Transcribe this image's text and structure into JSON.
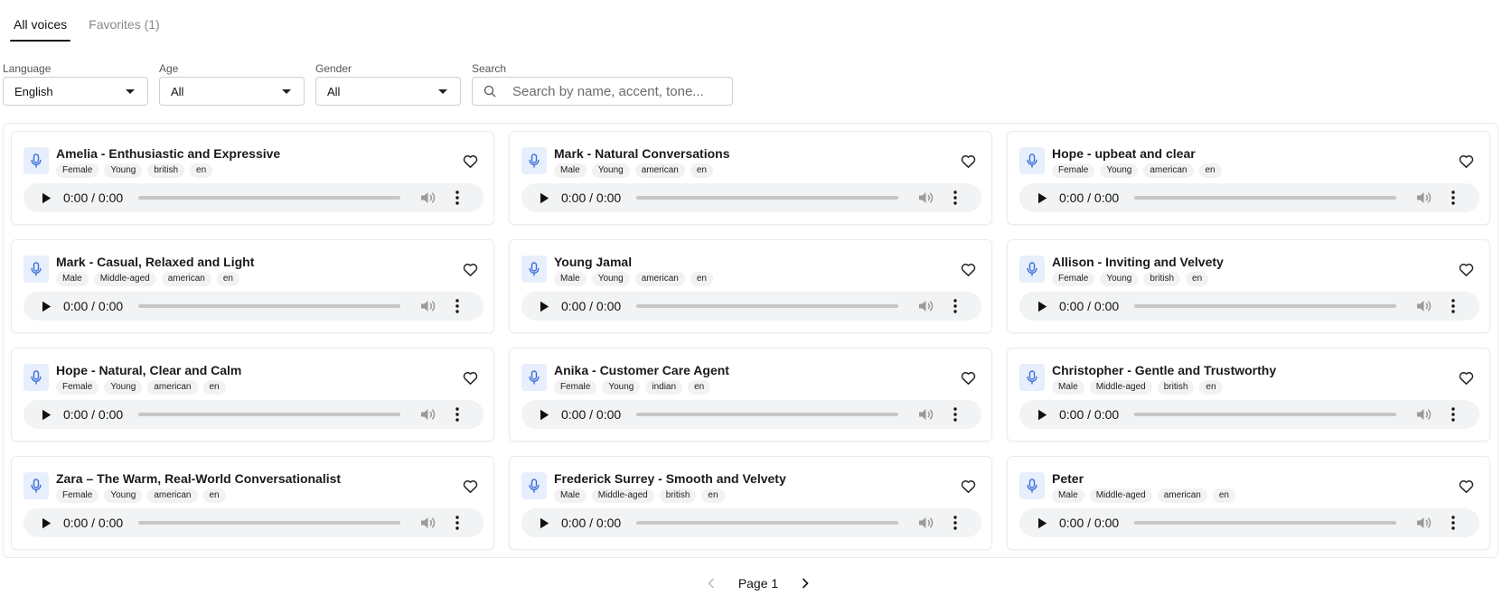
{
  "tabs": [
    {
      "label": "All voices",
      "active": true
    },
    {
      "label": "Favorites (1)",
      "active": false
    }
  ],
  "filters": {
    "language": {
      "label": "Language",
      "value": "English"
    },
    "age": {
      "label": "Age",
      "value": "All"
    },
    "gender": {
      "label": "Gender",
      "value": "All"
    },
    "search": {
      "label": "Search",
      "placeholder": "Search by name, accent, tone..."
    }
  },
  "player": {
    "time": "0:00 / 0:00"
  },
  "voices": [
    {
      "name": "Amelia - Enthusiastic and Expressive",
      "tags": [
        "Female",
        "Young",
        "british",
        "en"
      ]
    },
    {
      "name": "Mark - Natural Conversations",
      "tags": [
        "Male",
        "Young",
        "american",
        "en"
      ]
    },
    {
      "name": "Hope - upbeat and clear",
      "tags": [
        "Female",
        "Young",
        "american",
        "en"
      ]
    },
    {
      "name": "Mark - Casual, Relaxed and Light",
      "tags": [
        "Male",
        "Middle-aged",
        "american",
        "en"
      ]
    },
    {
      "name": "Young Jamal",
      "tags": [
        "Male",
        "Young",
        "american",
        "en"
      ]
    },
    {
      "name": "Allison - Inviting and Velvety",
      "tags": [
        "Female",
        "Young",
        "british",
        "en"
      ]
    },
    {
      "name": "Hope - Natural, Clear and Calm",
      "tags": [
        "Female",
        "Young",
        "american",
        "en"
      ]
    },
    {
      "name": "Anika - Customer Care Agent",
      "tags": [
        "Female",
        "Young",
        "indian",
        "en"
      ]
    },
    {
      "name": "Christopher - Gentle and Trustworthy",
      "tags": [
        "Male",
        "Middle-aged",
        "british",
        "en"
      ]
    },
    {
      "name": "Zara – The Warm, Real-World Conversationalist",
      "tags": [
        "Female",
        "Young",
        "american",
        "en"
      ]
    },
    {
      "name": "Frederick Surrey - Smooth and Velvety",
      "tags": [
        "Male",
        "Middle-aged",
        "british",
        "en"
      ]
    },
    {
      "name": "Peter",
      "tags": [
        "Male",
        "Middle-aged",
        "american",
        "en"
      ]
    }
  ],
  "pagination": {
    "label": "Page 1"
  },
  "colors": {
    "accent": "#3b6fd8",
    "mic_bg": "#e7eefc",
    "player_bg": "#f1f3f4"
  },
  "icons": {
    "mic": "mic-icon",
    "heart": "heart-outline-icon",
    "play": "play-icon",
    "volume": "volume-icon",
    "more": "more-vertical-icon",
    "search": "search-icon",
    "prev": "chevron-left-icon",
    "next": "chevron-right-icon"
  }
}
